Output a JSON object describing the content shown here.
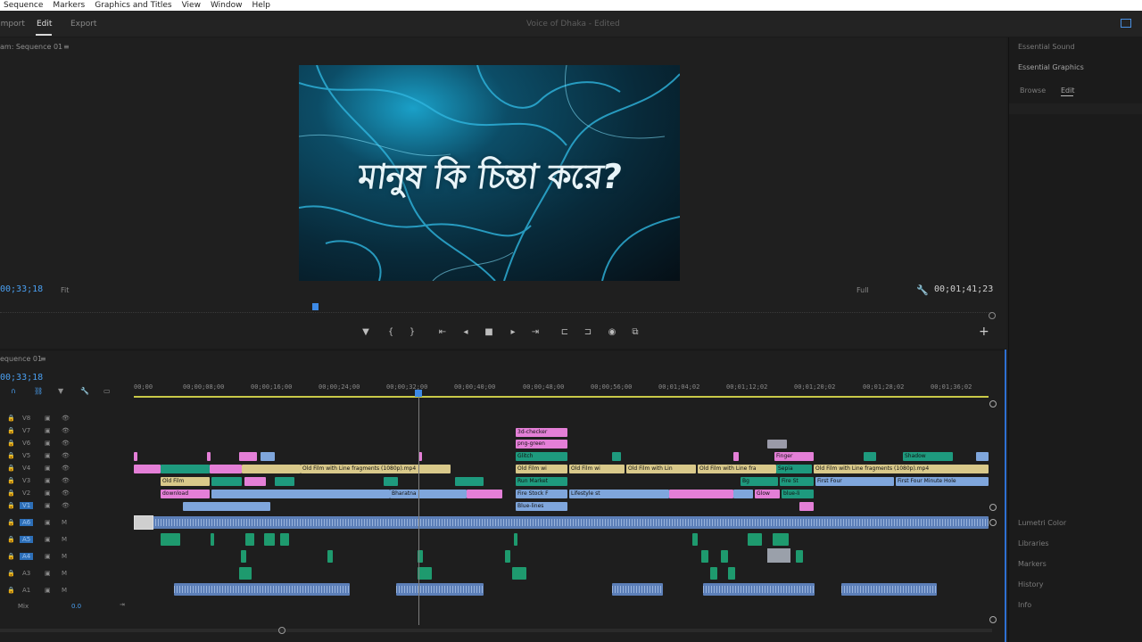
{
  "menu": [
    "Sequence",
    "Markers",
    "Graphics and Titles",
    "View",
    "Window",
    "Help"
  ],
  "workspace_tabs": [
    "Import",
    "Edit",
    "Export"
  ],
  "active_tab": "Edit",
  "document_title": "Voice of Dhaka - Edited",
  "program": {
    "panel_title": "am: Sequence 01",
    "current_time": "00;33;18",
    "fit": "Fit",
    "quality": "Full",
    "duration": "00;01;41;23",
    "video_text": "মানুষ কি চিন্তা করে?"
  },
  "right_panel": {
    "essential_sound": "Essential Sound",
    "essential_graphics": "Essential Graphics",
    "browse": "Browse",
    "edit": "Edit",
    "lower": [
      "Lumetri Color",
      "Libraries",
      "Markers",
      "History",
      "Info"
    ]
  },
  "timeline": {
    "panel_title": "equence 01",
    "current_time": "00;33;18",
    "ruler": [
      "00;00",
      "00;00;08;00",
      "00;00;16;00",
      "00;00;24;00",
      "00;00;32;00",
      "00;00;40;00",
      "00;00;48;00",
      "00;00;56;00",
      "00;01;04;02",
      "00;01;12;02",
      "00;01;20;02",
      "00;01;28;02",
      "00;01;36;02"
    ],
    "video_tracks": [
      "V8",
      "V7",
      "V6",
      "V5",
      "V4",
      "V3",
      "V2",
      "V1"
    ],
    "audio_tracks": [
      "A1",
      "A2",
      "A3",
      "A4",
      "A5",
      "A6"
    ],
    "mix_label": "Mix",
    "mix_value": "0.0",
    "clips": {
      "c1": "3d-checker",
      "c2": "png-green",
      "c3": "Glitch",
      "c4": "Old Film with Line fragments (1080p).mp4",
      "c5": "Old Film wi",
      "c6": "Old Film wi",
      "c7": "Old Film with Lin",
      "c8": "Old Film with Line fra",
      "c9": "Old Film with Line fragments (1080p).mp4",
      "c10": "Old Film",
      "c11": "download",
      "c12": "Run Market",
      "c13": "Fire Stock F",
      "c14": "Lifestyle st",
      "c15": "Blue-lines",
      "c16": "Finger",
      "c17": "First Four",
      "c18": "First Four Minute Hole",
      "c19": "Bharatna",
      "c20": "Bg",
      "c21": "Fire St",
      "c22": "blue-li",
      "c23": "Glow",
      "c24": "Shadow",
      "c25": "Sepia"
    }
  }
}
